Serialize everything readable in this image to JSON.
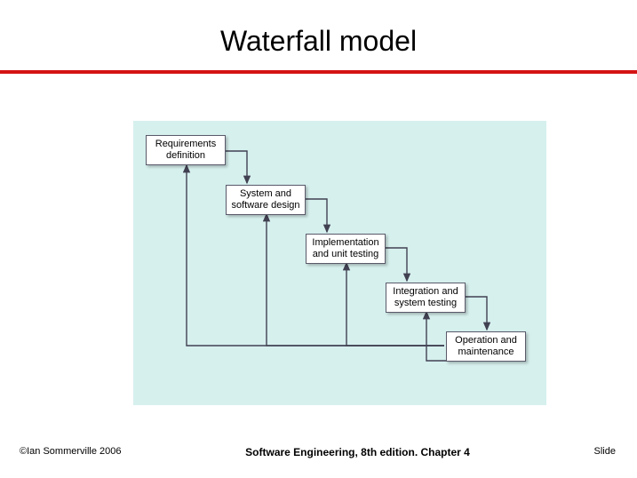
{
  "title": "Waterfall model",
  "diagram": {
    "boxes": [
      {
        "line1": "Requirements",
        "line2": "definition"
      },
      {
        "line1": "System and",
        "line2": "software design"
      },
      {
        "line1": "Implementation",
        "line2": "and unit testing"
      },
      {
        "line1": "Integration and",
        "line2": "system testing"
      },
      {
        "line1": "Operation and",
        "line2": "maintenance"
      }
    ]
  },
  "footer": {
    "left": "©Ian Sommerville 2006",
    "center": "Software Engineering, 8th edition. Chapter 4",
    "right": "Slide"
  }
}
